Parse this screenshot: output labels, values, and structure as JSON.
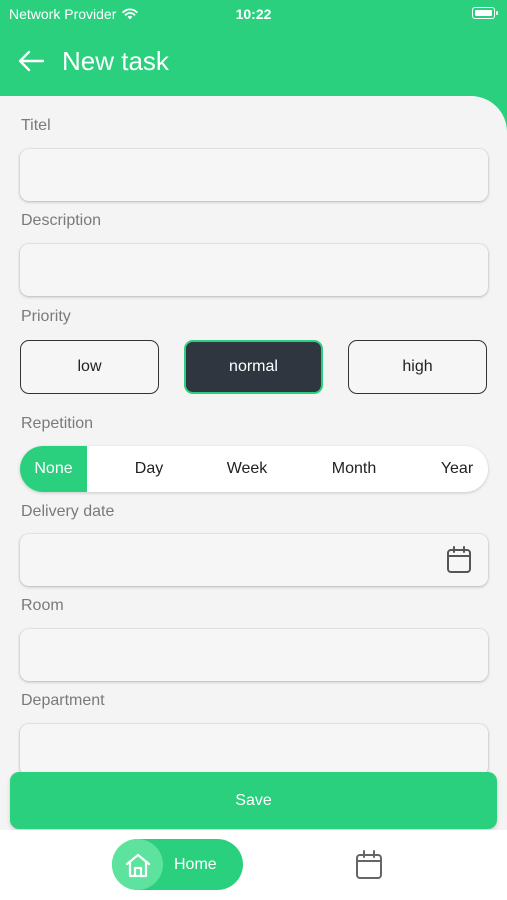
{
  "status": {
    "carrier": "Network Provider",
    "time": "10:22"
  },
  "header": {
    "title": "New task"
  },
  "form": {
    "title_label": "Titel",
    "title_value": "",
    "description_label": "Description",
    "description_value": "",
    "priority_label": "Priority",
    "priority_options": [
      "low",
      "normal",
      "high"
    ],
    "priority_selected": "normal",
    "repetition_label": "Repetition",
    "repetition_options": [
      "None",
      "Day",
      "Week",
      "Month",
      "Year"
    ],
    "repetition_selected": "None",
    "delivery_label": "Delivery date",
    "delivery_value": "",
    "room_label": "Room",
    "room_value": "",
    "department_label": "Department",
    "department_value": ""
  },
  "save_label": "Save",
  "nav": {
    "home_label": "Home"
  },
  "colors": {
    "accent": "#2ad07d",
    "dark": "#2f3640"
  }
}
